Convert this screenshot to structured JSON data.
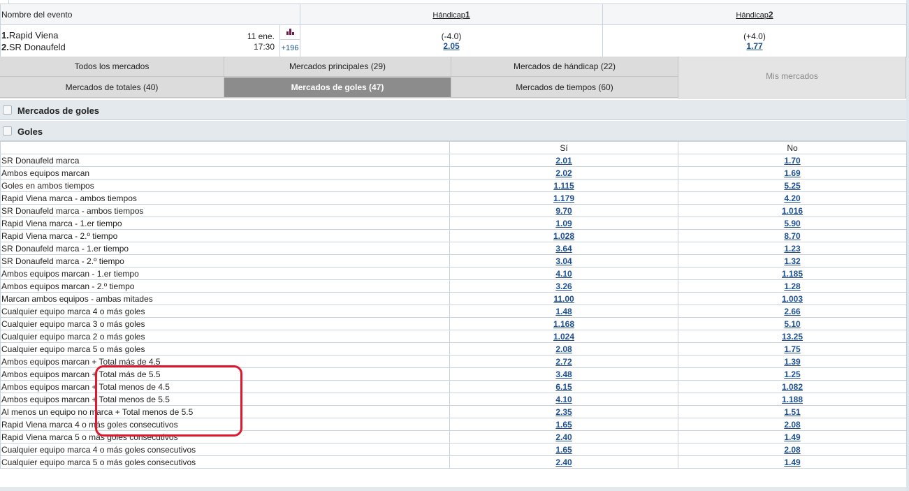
{
  "event_header": {
    "name_label": "Nombre del evento",
    "handicap1_label": "Hándicap",
    "handicap1_num": "1",
    "handicap2_label": "Hándicap",
    "handicap2_num": "2"
  },
  "event": {
    "team1_num": "1.",
    "team1": "Rapid Viena",
    "team2_num": "2.",
    "team2": "SR Donaufeld",
    "date": "11 ene.",
    "time": "17:30",
    "more_markets": "+196",
    "handicap1_value": "(-4.0)",
    "handicap1_odd": "2.05",
    "handicap2_value": "(+4.0)",
    "handicap2_odd": "1.77"
  },
  "tabs": {
    "todos": "Todos los mercados",
    "principales": "Mercados principales (29)",
    "handicap": "Mercados de hándicap (22)",
    "totales": "Mercados de totales (40)",
    "goles": "Mercados de goles (47)",
    "tiempos": "Mercados de tiempos (60)",
    "mis": "Mis mercados"
  },
  "sections": {
    "mercados_goles": "Mercados de goles",
    "goles": "Goles"
  },
  "columns": {
    "yes": "Sí",
    "no": "No"
  },
  "markets": [
    {
      "name": "SR Donaufeld marca",
      "yes": "2.01",
      "no": "1.70"
    },
    {
      "name": "Ambos equipos marcan",
      "yes": "2.02",
      "no": "1.69"
    },
    {
      "name": "Goles en ambos tiempos",
      "yes": "1.115",
      "no": "5.25"
    },
    {
      "name": "Rapid Viena marca - ambos tiempos",
      "yes": "1.179",
      "no": "4.20"
    },
    {
      "name": "SR Donaufeld marca - ambos tiempos",
      "yes": "9.70",
      "no": "1.016"
    },
    {
      "name": "Rapid Viena marca - 1.er tiempo",
      "yes": "1.09",
      "no": "5.90"
    },
    {
      "name": "Rapid Viena marca - 2.º tiempo",
      "yes": "1.028",
      "no": "8.70"
    },
    {
      "name": "SR Donaufeld marca - 1.er tiempo",
      "yes": "3.64",
      "no": "1.23"
    },
    {
      "name": "SR Donaufeld marca - 2.º tiempo",
      "yes": "3.04",
      "no": "1.32"
    },
    {
      "name": "Ambos equipos marcan - 1.er tiempo",
      "yes": "4.10",
      "no": "1.185"
    },
    {
      "name": "Ambos equipos marcan - 2.º tiempo",
      "yes": "3.26",
      "no": "1.28"
    },
    {
      "name": "Marcan ambos equipos - ambas mitades",
      "yes": "11.00",
      "no": "1.003"
    },
    {
      "name": "Cualquier equipo marca 4 o más goles",
      "yes": "1.48",
      "no": "2.66"
    },
    {
      "name": "Cualquier equipo marca 3 o más goles",
      "yes": "1.168",
      "no": "5.10"
    },
    {
      "name": "Cualquier equipo marca 2 o más goles",
      "yes": "1.024",
      "no": "13.25"
    },
    {
      "name": "Cualquier equipo marca 5 o más goles",
      "yes": "2.08",
      "no": "1.75"
    },
    {
      "name": "Ambos equipos marcan + Total más de 4.5",
      "yes": "2.72",
      "no": "1.39"
    },
    {
      "name": "Ambos equipos marcan + Total más de 5.5",
      "yes": "3.48",
      "no": "1.25"
    },
    {
      "name": "Ambos equipos marcan + Total menos de 4.5",
      "yes": "6.15",
      "no": "1.082"
    },
    {
      "name": "Ambos equipos marcan + Total menos de 5.5",
      "yes": "4.10",
      "no": "1.188"
    },
    {
      "name": "Al menos un equipo no marca + Total menos de 5.5",
      "yes": "2.35",
      "no": "1.51"
    },
    {
      "name": "Rapid Viena marca 4 o más goles consecutivos",
      "yes": "1.65",
      "no": "2.08"
    },
    {
      "name": "Rapid Viena marca 5 o más goles consecutivos",
      "yes": "2.40",
      "no": "1.49"
    },
    {
      "name": "Cualquier equipo marca 4 o más goles consecutivos",
      "yes": "1.65",
      "no": "2.08"
    },
    {
      "name": "Cualquier equipo marca 5 o más goles consecutivos",
      "yes": "2.40",
      "no": "1.49"
    }
  ],
  "colors": {
    "link": "#1d4f91",
    "active_tab": "#8c8c8c",
    "highlight": "#e0182d",
    "stats_icon": "#7a1c4a"
  }
}
